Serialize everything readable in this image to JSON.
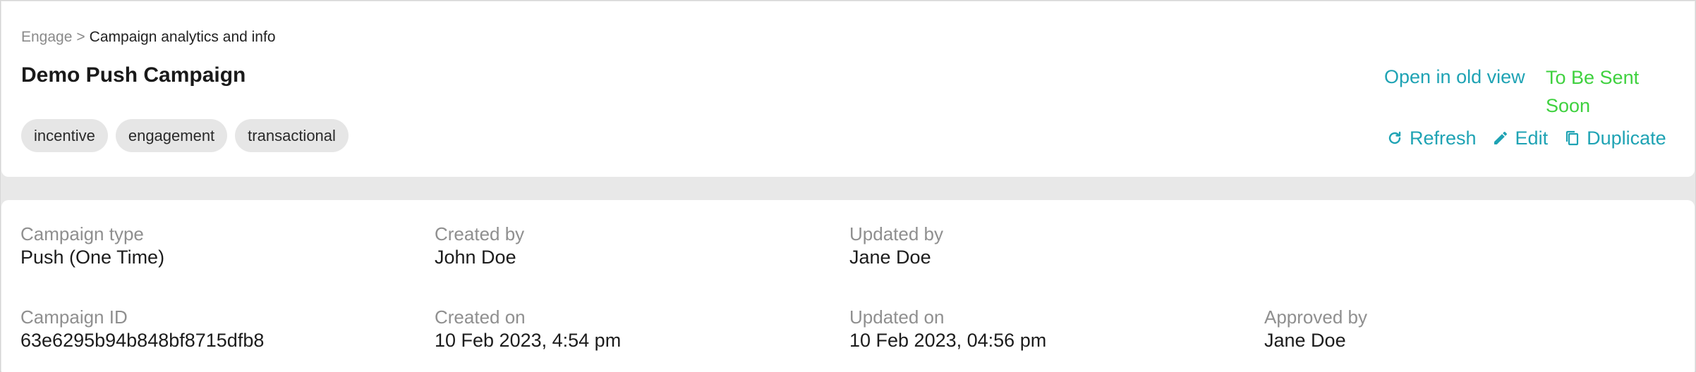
{
  "breadcrumb": {
    "root": "Engage",
    "separator": ">",
    "current": "Campaign analytics and info"
  },
  "page_title": "Demo Push Campaign",
  "tags": [
    "incentive",
    "engagement",
    "transactional"
  ],
  "header_actions": {
    "old_view_label": "Open in old view",
    "status": "To Be Sent Soon",
    "status_color": "#3fd13f",
    "accent_color": "#1fa3b4",
    "refresh": {
      "label": "Refresh",
      "icon": "refresh-icon"
    },
    "edit": {
      "label": "Edit",
      "icon": "pencil-icon"
    },
    "duplicate": {
      "label": "Duplicate",
      "icon": "copy-icon"
    }
  },
  "details": {
    "campaign_type": {
      "label": "Campaign type",
      "value": "Push (One Time)"
    },
    "created_by": {
      "label": "Created by",
      "value": "John Doe"
    },
    "updated_by": {
      "label": "Updated by",
      "value": "Jane Doe"
    },
    "campaign_id": {
      "label": "Campaign ID",
      "value": "63e6295b94b848bf8715dfb8"
    },
    "created_on": {
      "label": "Created on",
      "value": "10 Feb 2023, 4:54 pm"
    },
    "updated_on": {
      "label": "Updated on",
      "value": "10 Feb 2023, 04:56 pm"
    },
    "approved_by": {
      "label": "Approved by",
      "value": "Jane Doe"
    }
  }
}
